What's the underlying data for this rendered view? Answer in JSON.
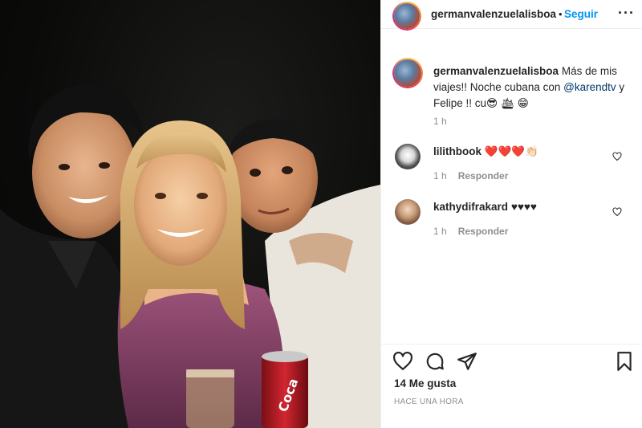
{
  "post": {
    "username": "germanvalenzuelalisboa",
    "follow_label": "Seguir",
    "dot": "•",
    "more_label": "···",
    "caption": {
      "username": "germanvalenzuelalisboa",
      "text_1": "Más de mis viajes!! Noche cubana con ",
      "mention": "@karendtv",
      "text_2": " y Felipe !! cu😎 🛳 😁",
      "time": "1 h"
    },
    "comments": [
      {
        "username": "lilithbook",
        "text": "❤️❤️❤️👏🏻",
        "time": "1 h",
        "reply_label": "Responder"
      },
      {
        "username": "kathydifrakard",
        "text": "♥♥♥♥",
        "time": "1 h",
        "reply_label": "Responder"
      }
    ],
    "likes": "14 Me gusta",
    "posted_ago": "HACE UNA HORA"
  },
  "icons": {
    "like": "heart-icon",
    "comment": "comment-icon",
    "share": "share-icon",
    "save": "bookmark-icon"
  },
  "colors": {
    "link_blue": "#0095f6",
    "mention": "#00376b",
    "muted": "#8e8e8e",
    "text": "#262626"
  }
}
